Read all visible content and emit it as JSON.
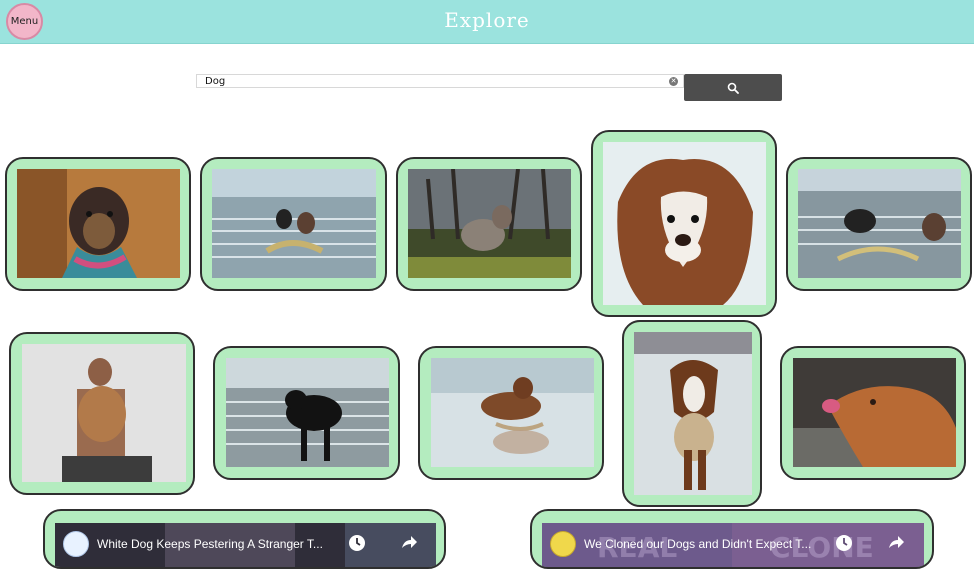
{
  "header": {
    "menu_label": "Menu",
    "title": "Explore"
  },
  "search": {
    "value": "Dog",
    "clear_icon": "clear-icon",
    "button_icon": "search-icon"
  },
  "colors": {
    "header_bg": "#9be3de",
    "card_bg": "#b4ecbf",
    "search_button_bg": "#4d4d4d",
    "menu_button_bg": "#f2b6c9"
  },
  "gallery": {
    "images": [
      {
        "subject": "dog-with-bandana"
      },
      {
        "subject": "two-dogs-beach"
      },
      {
        "subject": "dog-in-forest"
      },
      {
        "subject": "spaniel-windblown"
      },
      {
        "subject": "two-dogs-water"
      },
      {
        "subject": "man-holding-dog"
      },
      {
        "subject": "black-dog-beach"
      },
      {
        "subject": "spaniel-wet-sand"
      },
      {
        "subject": "spaniel-running"
      },
      {
        "subject": "dog-licking-lips"
      }
    ]
  },
  "videos": [
    {
      "title": "White Dog Keeps Pestering A Stranger T...",
      "watch_icon": "clock-icon",
      "share_icon": "share-icon"
    },
    {
      "title": "We Cloned our Dogs and Didn't Expect T...",
      "watch_icon": "clock-icon",
      "share_icon": "share-icon"
    }
  ]
}
